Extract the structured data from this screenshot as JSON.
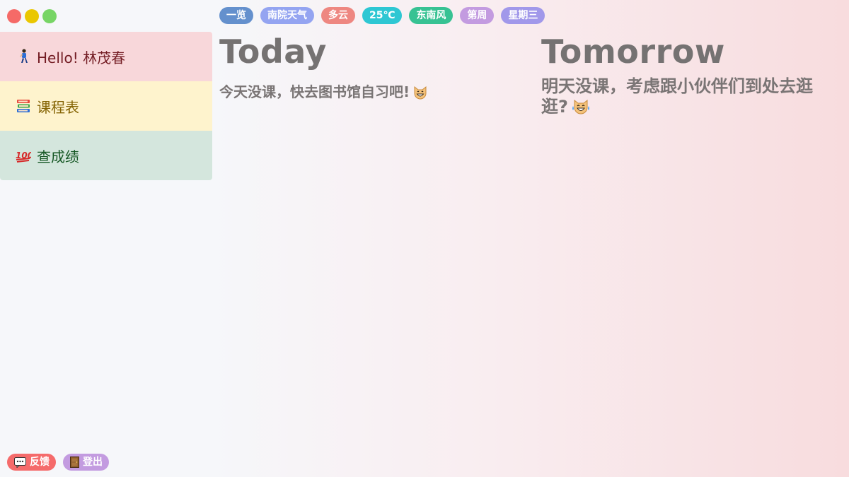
{
  "window": {
    "controls": [
      "close",
      "minimize",
      "maximize"
    ]
  },
  "pills": [
    {
      "label": "一览",
      "color": "#6490cd"
    },
    {
      "label": "南院天气",
      "color": "#94a4f1"
    },
    {
      "label": "多云",
      "color": "#ee8781"
    },
    {
      "label": "25℃",
      "color": "#2ec7d3"
    },
    {
      "label": "东南风",
      "color": "#37c293"
    },
    {
      "label": "第周",
      "color": "#c39be0"
    },
    {
      "label": "星期三",
      "color": "#a198ea"
    }
  ],
  "sidebar": {
    "items": [
      {
        "label": "Hello! 林茂春",
        "icon": "person-walking-icon"
      },
      {
        "label": "课程表",
        "icon": "books-icon"
      },
      {
        "label": "查成绩",
        "icon": "hundred-points-icon"
      }
    ]
  },
  "today": {
    "title": "Today",
    "message": "今天没课，快去图书馆自习吧!",
    "emoji": "grinning-cat-icon"
  },
  "tomorrow": {
    "title": "Tomorrow",
    "message": "明天没课，考虑跟小伙伴们到处去逛逛?",
    "emoji": "cat-tears-of-joy-icon"
  },
  "bottom": {
    "feedback_label": "反馈",
    "logout_label": "登出"
  }
}
